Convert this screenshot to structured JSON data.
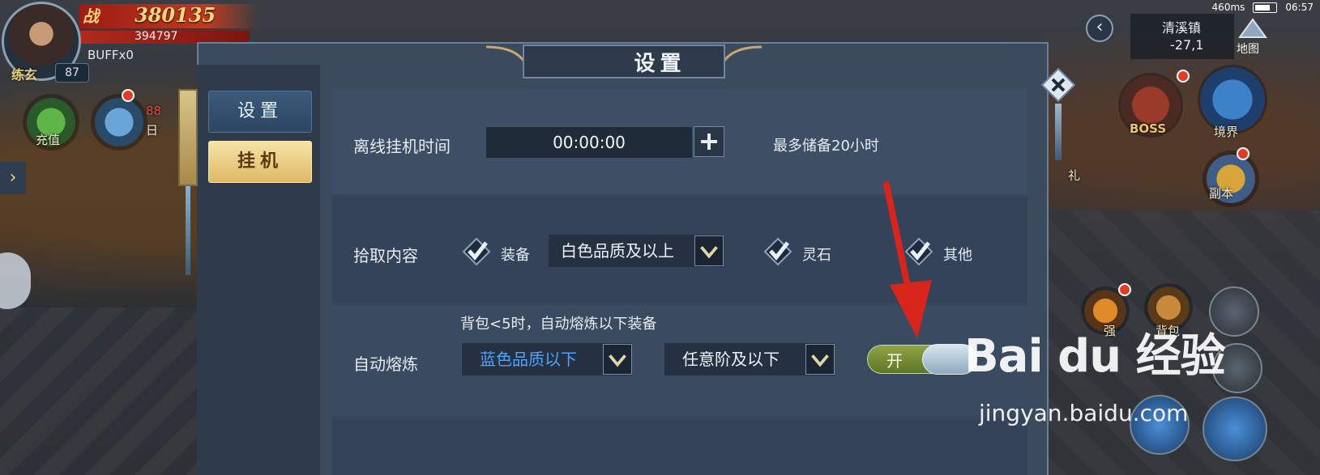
{
  "hud": {
    "player_name": "练玄",
    "level": "87",
    "power_icon": "战",
    "power": "380135",
    "hp": "394797",
    "buff": "BUFFx0",
    "recharge_label": "充值",
    "daily_label": "日",
    "daily_badge": "88"
  },
  "status": {
    "network": "460ms",
    "time": "06:57"
  },
  "location": {
    "name": "清溪镇",
    "coords": "-27,1",
    "map_label": "地图"
  },
  "right_icons": {
    "boss": "BOSS",
    "realm": "境界",
    "gift": "礼",
    "dungeon": "副本",
    "bag": "背包",
    "strengthen": "强"
  },
  "panel": {
    "title": "设置",
    "tabs": [
      {
        "label": "设置",
        "active": false
      },
      {
        "label": "挂机",
        "active": true
      }
    ]
  },
  "offline": {
    "label": "离线挂机时间",
    "value": "00:00:00",
    "note": "最多储备20小时"
  },
  "pickup": {
    "label": "拾取内容",
    "equip_label": "装备",
    "equip_quality": "白色品质及以上",
    "spirit_label": "灵石",
    "other_label": "其他"
  },
  "smelt": {
    "hint": "背包<5时，自动熔炼以下装备",
    "label": "自动熔炼",
    "quality": "蓝色品质以下",
    "tier": "任意阶及以下",
    "toggle_label": "开"
  },
  "watermark": {
    "logo": "Bai du 经验",
    "url": "jingyan.baidu.com"
  },
  "colors": {
    "panel_bg": "#3c4a5d",
    "active_tab": "#e0b966",
    "toggle_on": "#8fa546",
    "quality_blue": "#4ea3ff",
    "arrow_red": "#d8251b"
  }
}
